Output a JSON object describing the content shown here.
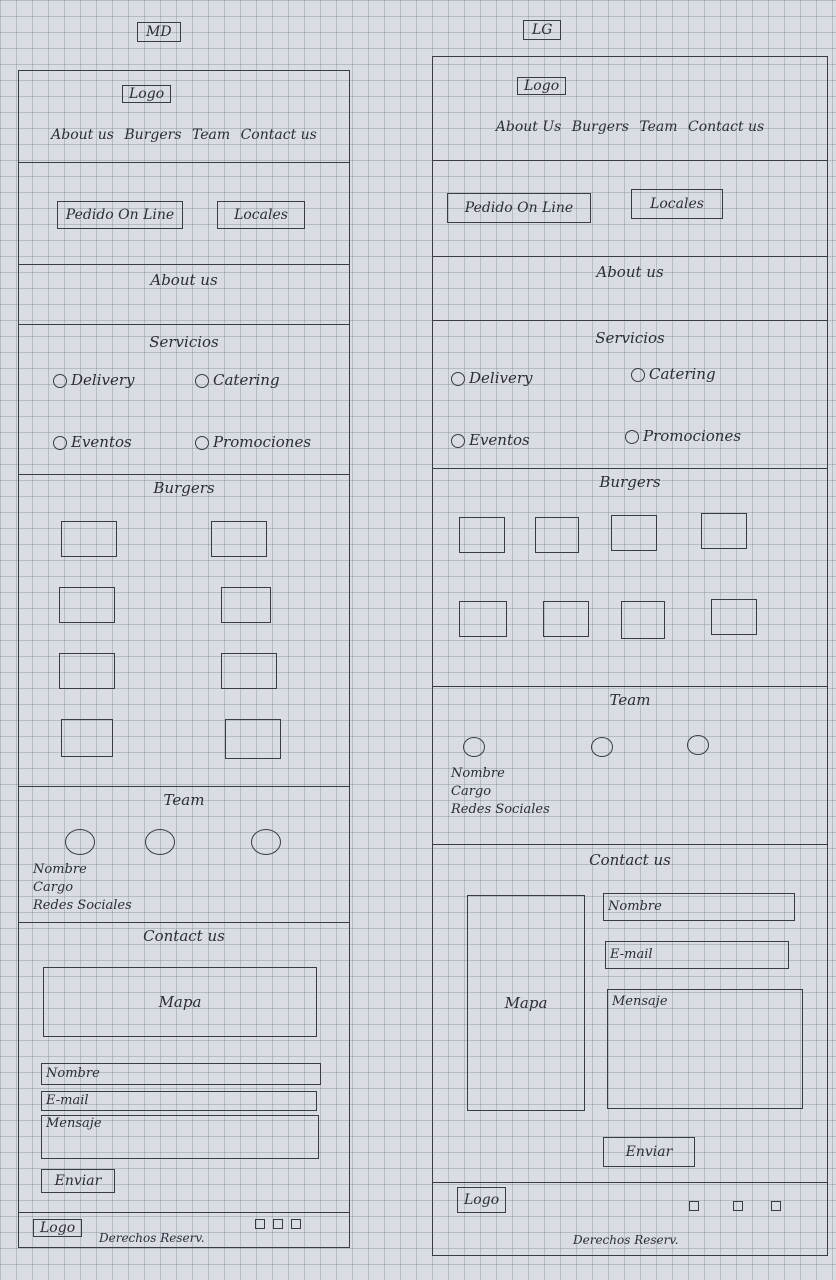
{
  "md": {
    "tag": "MD",
    "header": {
      "logo": "Logo",
      "nav": [
        "About us",
        "Burgers",
        "Team",
        "Contact us"
      ]
    },
    "hero": {
      "buttons": [
        "Pedido On Line",
        "Locales"
      ]
    },
    "about": {
      "title": "About us"
    },
    "services": {
      "title": "Servicios",
      "items": [
        "Delivery",
        "Catering",
        "Eventos",
        "Promociones"
      ]
    },
    "burgers": {
      "title": "Burgers"
    },
    "team": {
      "title": "Team",
      "info": [
        "Nombre",
        "Cargo",
        "Redes Sociales"
      ]
    },
    "contact": {
      "title": "Contact us",
      "map": "Mapa",
      "fields": [
        "Nombre",
        "E-mail",
        "Mensaje"
      ],
      "send": "Enviar"
    },
    "footer": {
      "logo": "Logo",
      "copyright": "Derechos Reserv."
    }
  },
  "lg": {
    "tag": "LG",
    "header": {
      "logo": "Logo",
      "nav": [
        "About Us",
        "Burgers",
        "Team",
        "Contact us"
      ]
    },
    "hero": {
      "buttons": [
        "Pedido On Line",
        "Locales"
      ]
    },
    "about": {
      "title": "About us"
    },
    "services": {
      "title": "Servicios",
      "items": [
        "Delivery",
        "Catering",
        "Eventos",
        "Promociones"
      ]
    },
    "burgers": {
      "title": "Burgers"
    },
    "team": {
      "title": "Team",
      "info": [
        "Nombre",
        "Cargo",
        "Redes Sociales"
      ]
    },
    "contact": {
      "title": "Contact us",
      "map": "Mapa",
      "fields": [
        "Nombre",
        "E-mail",
        "Mensaje"
      ],
      "send": "Enviar"
    },
    "footer": {
      "logo": "Logo",
      "copyright": "Derechos Reserv."
    }
  }
}
